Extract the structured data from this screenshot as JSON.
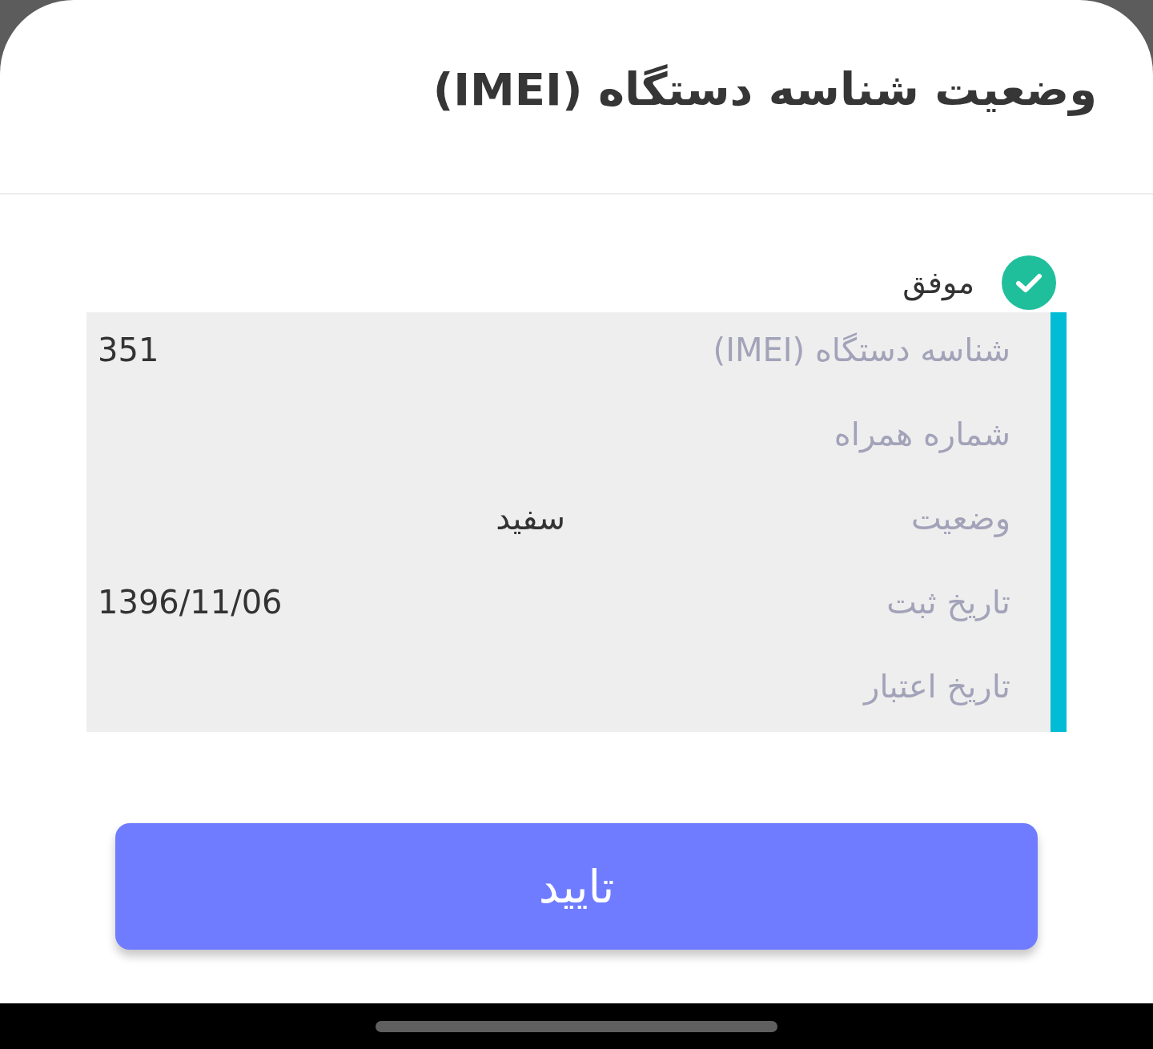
{
  "title": "وضعیت شناسه دستگاه (IMEI)",
  "result": {
    "kind": "success",
    "label": "موفق"
  },
  "details": [
    {
      "label": "شناسه دستگاه (IMEI)",
      "value": "351"
    },
    {
      "label": "شماره همراه"
    },
    {
      "label": "وضعیت",
      "value": "سفید"
    },
    {
      "label": "تاریخ ثبت",
      "value": "1396/11/06"
    },
    {
      "label": "تاریخ اعتبار"
    }
  ],
  "confirm_button": "تایید"
}
